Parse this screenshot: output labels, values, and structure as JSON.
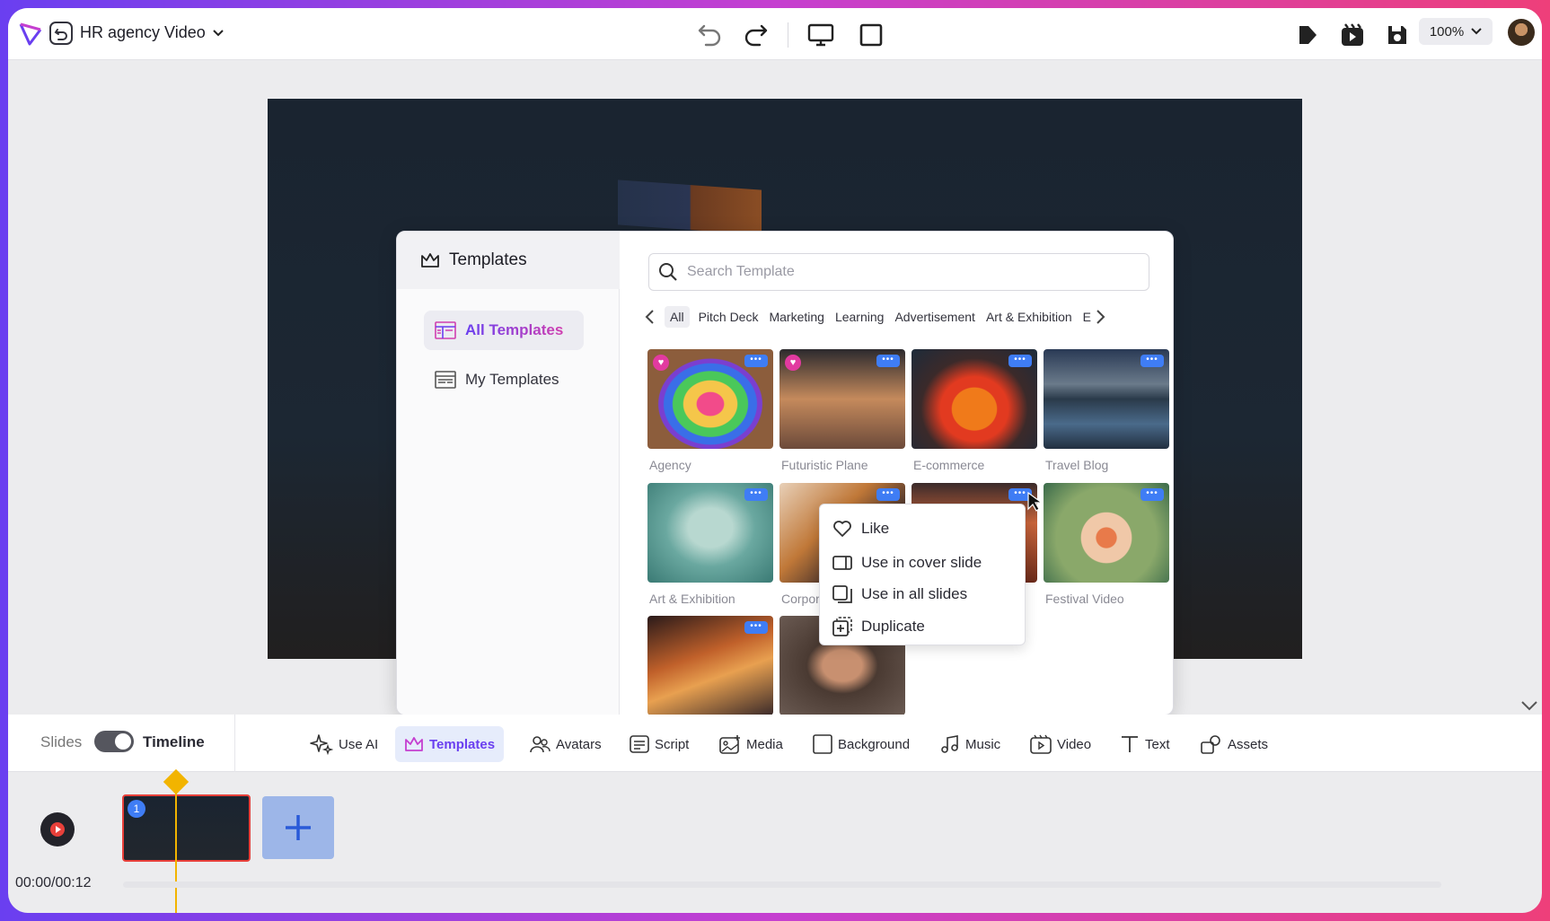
{
  "topbar": {
    "project_title": "HR agency Video",
    "zoom_level": "100%"
  },
  "templates_panel": {
    "title": "Templates",
    "nav": [
      {
        "label": "All Templates",
        "active": true
      },
      {
        "label": "My Templates",
        "active": false
      }
    ],
    "search": {
      "placeholder": "Search Template",
      "value": ""
    },
    "categories": [
      "All",
      "Pitch Deck",
      "Marketing",
      "Learning",
      "Advertisement",
      "Art & Exhibition",
      "E"
    ],
    "active_category": "All",
    "templates": [
      {
        "label": "Agency",
        "liked": true
      },
      {
        "label": "Futuristic Plane",
        "liked": true
      },
      {
        "label": "E-commerce",
        "liked": false
      },
      {
        "label": "Travel Blog",
        "liked": false
      },
      {
        "label": "Art & Exhibition",
        "liked": false
      },
      {
        "label": "Corpor",
        "liked": false
      },
      {
        "label": "",
        "liked": false
      },
      {
        "label": "Festival Video",
        "liked": false
      },
      {
        "label": "",
        "liked": false
      },
      {
        "label": "",
        "liked": false
      }
    ],
    "more_button": "•••"
  },
  "context_menu": {
    "items": [
      "Like",
      "Use in cover slide",
      "Use in all slides",
      "Duplicate"
    ]
  },
  "toolbar": {
    "mode_slides": "Slides",
    "mode_timeline": "Timeline",
    "tools": [
      "Use AI",
      "Templates",
      "Avatars",
      "Script",
      "Media",
      "Background",
      "Music",
      "Video",
      "Text",
      "Assets"
    ],
    "active_tool": "Templates"
  },
  "timeline": {
    "time": "00:00/00:12",
    "slide_number": "1"
  },
  "colors": {
    "accent": "#6a3ff0",
    "playhead": "#f2b400",
    "more_badge": "#3f7df5"
  }
}
